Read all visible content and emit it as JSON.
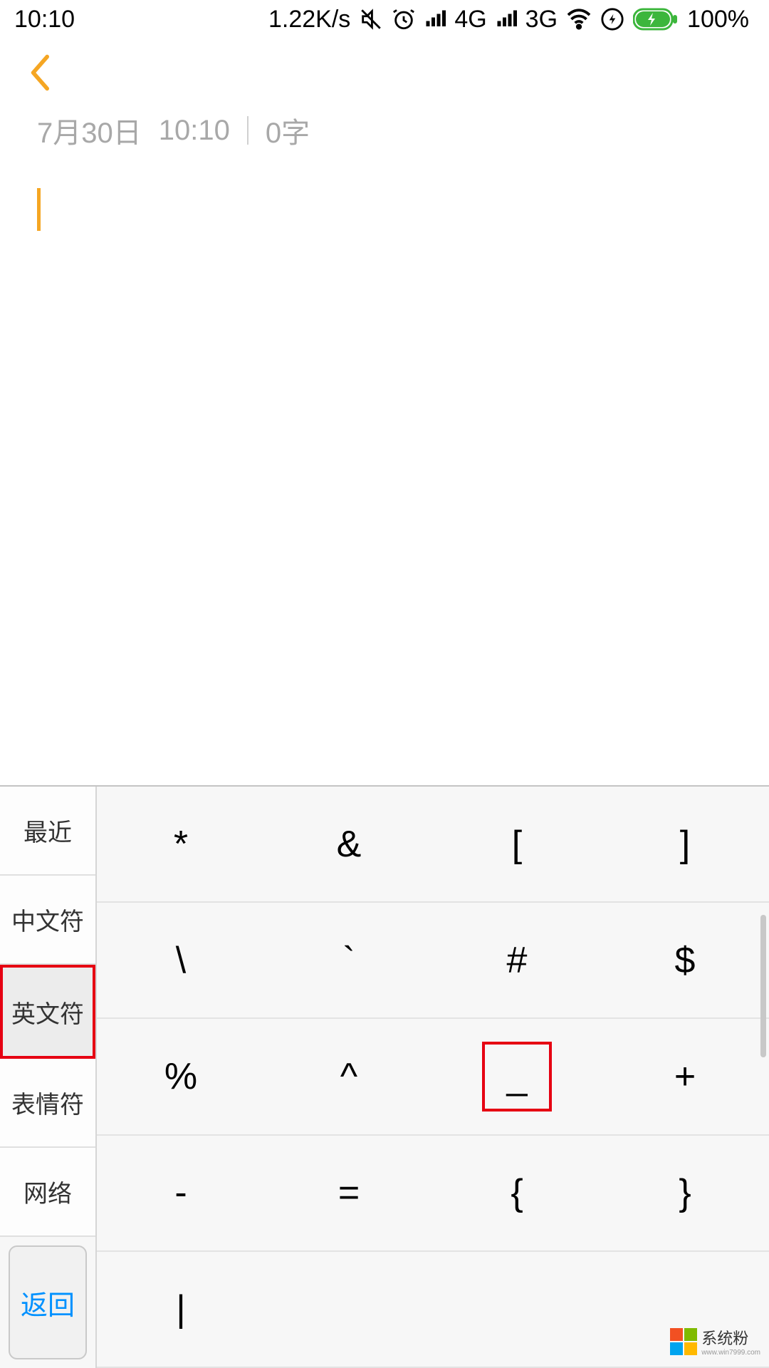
{
  "status": {
    "time": "10:10",
    "speed": "1.22K/s",
    "net1": "4G",
    "net2": "3G",
    "battery": "100%"
  },
  "meta": {
    "date": "7月30日",
    "time": "10:10",
    "count": "0字"
  },
  "keyboard": {
    "tabs": [
      "最近",
      "中文符",
      "英文符",
      "表情符",
      "网络"
    ],
    "selected_tab_index": 2,
    "return_label": "返回",
    "rows": [
      [
        "*",
        "&",
        "[",
        "]"
      ],
      [
        "\\",
        "`",
        "#",
        "$"
      ],
      [
        "%",
        "^",
        "_",
        "+"
      ],
      [
        "-",
        "=",
        "{",
        "}"
      ],
      [
        "|",
        "",
        "",
        ""
      ]
    ],
    "highlighted": {
      "row": 2,
      "col": 2
    }
  },
  "watermark": {
    "text": "系统粉",
    "sub": "www.win7999.com"
  }
}
